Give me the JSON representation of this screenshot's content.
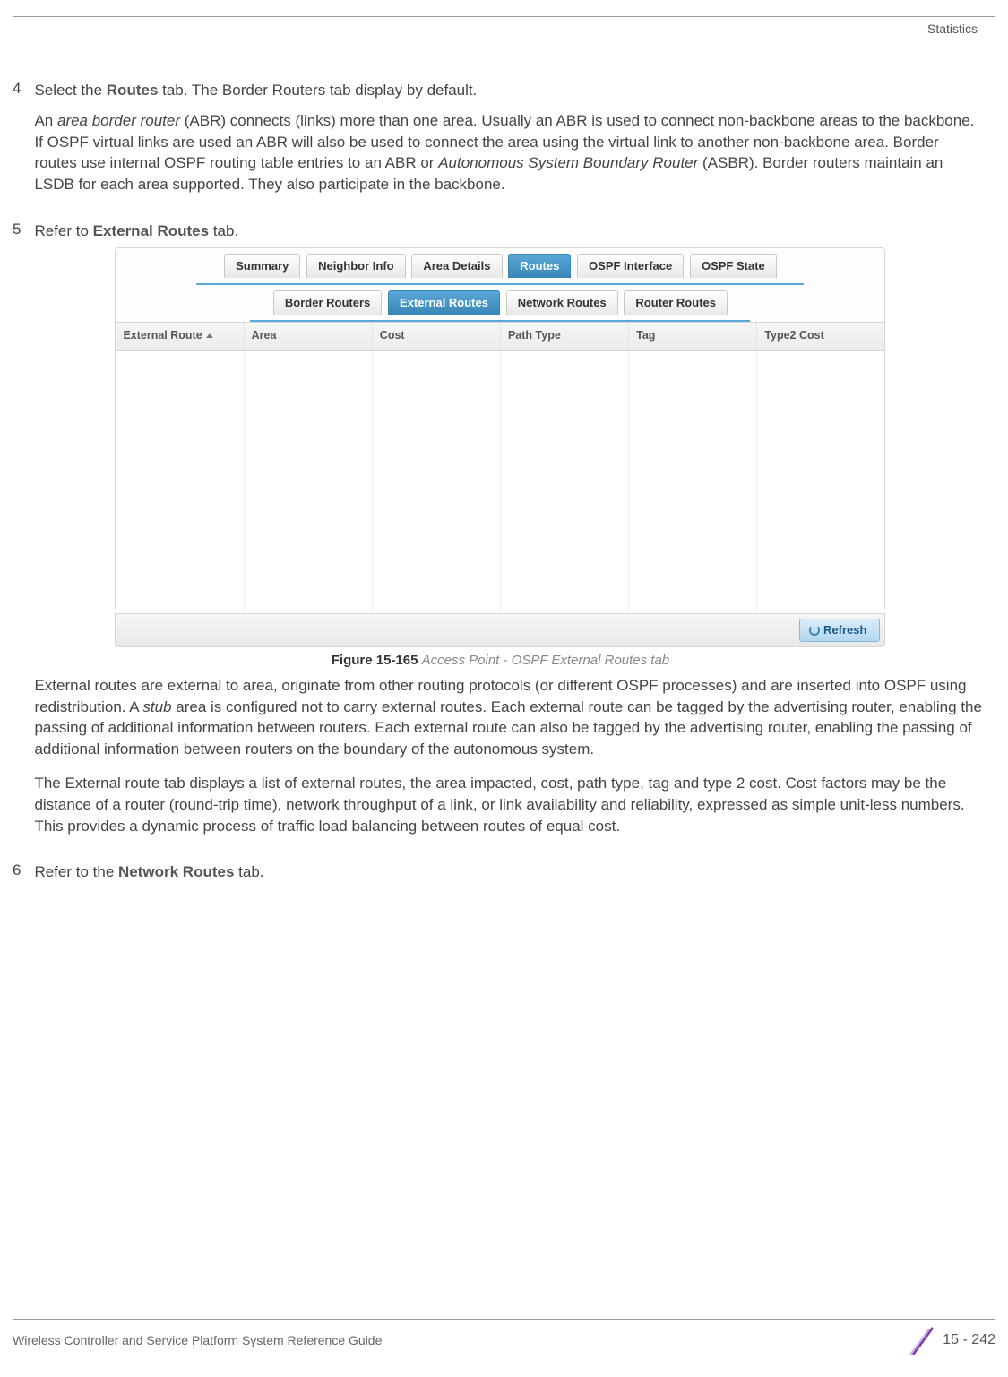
{
  "header": {
    "section": "Statistics"
  },
  "steps": {
    "s4": {
      "num": "4",
      "intro_pre": "Select the ",
      "intro_bold": "Routes",
      "intro_post": " tab. The Border Routers tab display by default.",
      "p1_a": "An ",
      "p1_i1": "area border router",
      "p1_b": " (ABR) connects (links) more than one area. Usually an ABR is used to connect non-backbone areas to the backbone. If OSPF virtual links are used an ABR will also be used to connect the area using the virtual link to another non-backbone area. Border routes use internal OSPF routing table entries to an ABR or ",
      "p1_i2": "Autonomous System Boundary Router",
      "p1_c": " (ASBR). Border routers maintain an LSDB for each area supported. They also participate in the backbone."
    },
    "s5": {
      "num": "5",
      "intro_pre": "Refer to ",
      "intro_bold": "External Routes",
      "intro_post": " tab.",
      "caption_bold": "Figure 15-165",
      "caption_italic": " Access Point - OSPF External Routes tab",
      "p1_a": "External routes are external to area, originate from other routing protocols (or different OSPF processes) and are inserted into OSPF using redistribution. A ",
      "p1_i1": "stub",
      "p1_b": " area is configured not to carry external routes. Each external route can be tagged by the advertising router, enabling the passing of additional information between routers. Each external route can also be tagged by the advertising router, enabling the passing of additional information between routers on the boundary of the autonomous system.",
      "p2": "The External route tab displays a list of external routes, the area impacted, cost, path type, tag and type 2 cost. Cost factors may be the distance of a router (round-trip time), network throughput of a link, or link availability and reliability, expressed as simple unit-less numbers. This provides a dynamic process of traffic load balancing between routes of equal cost."
    },
    "s6": {
      "num": "6",
      "intro_pre": "Refer to the ",
      "intro_bold": "Network Routes",
      "intro_post": " tab."
    }
  },
  "ui": {
    "tabs1": [
      "Summary",
      "Neighbor Info",
      "Area Details",
      "Routes",
      "OSPF Interface",
      "OSPF State"
    ],
    "tabs1_active": 3,
    "tabs2": [
      "Border Routers",
      "External Routes",
      "Network Routes",
      "Router Routes"
    ],
    "tabs2_active": 1,
    "columns": [
      "External Route",
      "Area",
      "Cost",
      "Path Type",
      "Tag",
      "Type2 Cost"
    ],
    "refresh": "Refresh"
  },
  "footer": {
    "guide": "Wireless Controller and Service Platform System Reference Guide",
    "page": "15 - 242"
  }
}
